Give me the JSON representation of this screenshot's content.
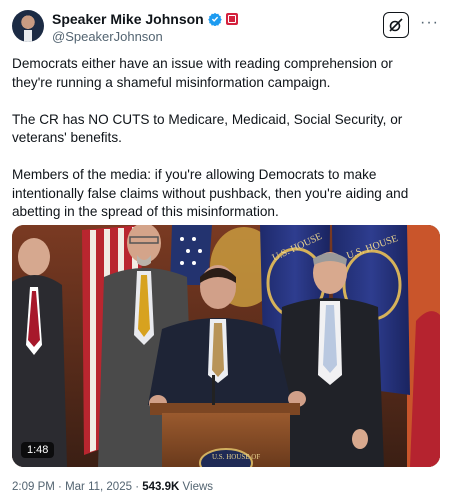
{
  "header": {
    "display_name": "Speaker Mike Johnson",
    "handle": "@SpeakerJohnson",
    "verified_badge_icon": "verified-badge-icon",
    "affiliate_badge_icon": "house-seal-badge-icon",
    "grok_icon": "grok-icon",
    "more_icon": "more-icon",
    "more_label": "···"
  },
  "tweet": {
    "paragraph_1": "Democrats either have an issue with reading comprehension or they're running a shameful misinformation campaign.",
    "paragraph_2": "The CR has NO CUTS to Medicare, Medicaid, Social Security, or veterans' benefits.",
    "paragraph_3": "Members of the media: if you're allowing Democrats to make intentionally false claims without pushback, then you're aiding and abetting in the spread of this misinformation."
  },
  "media": {
    "type": "video",
    "duration": "1:48",
    "podium_seal_text": "U.S. HOUSE OF",
    "flag_text_left": "U.S. HOUSE",
    "flag_text_right": "U.S. HOUSE"
  },
  "meta": {
    "time": "2:09 PM",
    "date": "Mar 11, 2025",
    "separator": "·",
    "views_count": "543.9K",
    "views_label": "Views"
  },
  "colors": {
    "text_primary": "#0f1419",
    "text_secondary": "#536471",
    "verified_blue": "#1d9bf0"
  }
}
